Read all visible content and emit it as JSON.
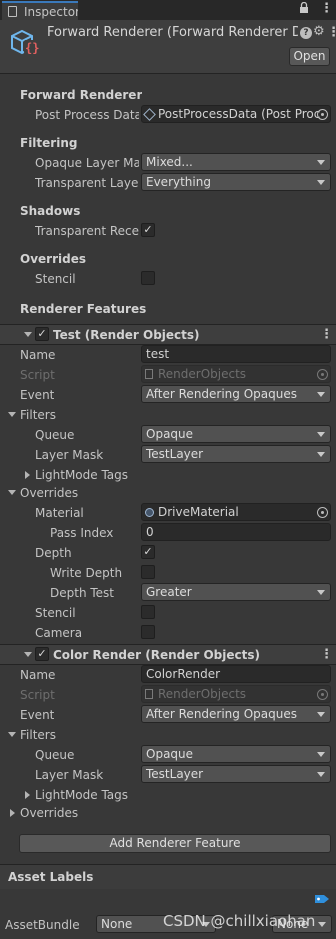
{
  "window": {
    "tab_label": "Inspector",
    "lock_glyph": "🔒",
    "menu_glyph": "⋮"
  },
  "header": {
    "title": "Forward Renderer (Forward Renderer D",
    "help_glyph": "?",
    "settings_glyph": "⚙",
    "more_glyph": "⋮",
    "open_label": "Open"
  },
  "forward_renderer": {
    "section_label": "Forward Renderer",
    "post_process_label": "Post Process Data",
    "post_process_value": "PostProcessData (Post Proc"
  },
  "filtering": {
    "section_label": "Filtering",
    "opaque_label": "Opaque Layer Mas",
    "opaque_value": "Mixed...",
    "transparent_label": "Transparent Layer",
    "transparent_value": "Everything"
  },
  "shadows": {
    "section_label": "Shadows",
    "transparent_receive_label": "Transparent Recei",
    "transparent_receive_checked": "✓"
  },
  "overrides": {
    "section_label": "Overrides",
    "stencil_label": "Stencil"
  },
  "renderer_features_label": "Renderer Features",
  "feature1": {
    "title": "Test (Render Objects)",
    "checked": "✓",
    "name_label": "Name",
    "name_value": "test",
    "script_label": "Script",
    "script_value": "RenderObjects",
    "event_label": "Event",
    "event_value": "After Rendering Opaques",
    "filters_label": "Filters",
    "queue_label": "Queue",
    "queue_value": "Opaque",
    "layer_mask_label": "Layer Mask",
    "layer_mask_value": "TestLayer",
    "lightmode_label": "LightMode Tags",
    "overrides_label": "Overrides",
    "material_label": "Material",
    "material_value": "DriveMaterial",
    "pass_index_label": "Pass Index",
    "pass_index_value": "0",
    "depth_label": "Depth",
    "depth_checked": "✓",
    "write_depth_label": "Write Depth",
    "depth_test_label": "Depth Test",
    "depth_test_value": "Greater",
    "stencil_label": "Stencil",
    "camera_label": "Camera"
  },
  "feature2": {
    "title": "Color Render (Render Objects)",
    "checked": "✓",
    "name_label": "Name",
    "name_value": "ColorRender",
    "script_label": "Script",
    "script_value": "RenderObjects",
    "event_label": "Event",
    "event_value": "After Rendering Opaques",
    "filters_label": "Filters",
    "queue_label": "Queue",
    "queue_value": "Opaque",
    "layer_mask_label": "Layer Mask",
    "layer_mask_value": "TestLayer",
    "lightmode_label": "LightMode Tags",
    "overrides_label": "Overrides"
  },
  "add_feature_label": "Add Renderer Feature",
  "asset_labels": {
    "section_label": "Asset Labels",
    "assetbundle_label": "AssetBundle",
    "assetbundle_value": "None",
    "variant_value": "None"
  },
  "watermark": "CSDN @chillxiaohan",
  "colors": {
    "accent_blue": "#2f8fdc",
    "background": "#383838"
  }
}
